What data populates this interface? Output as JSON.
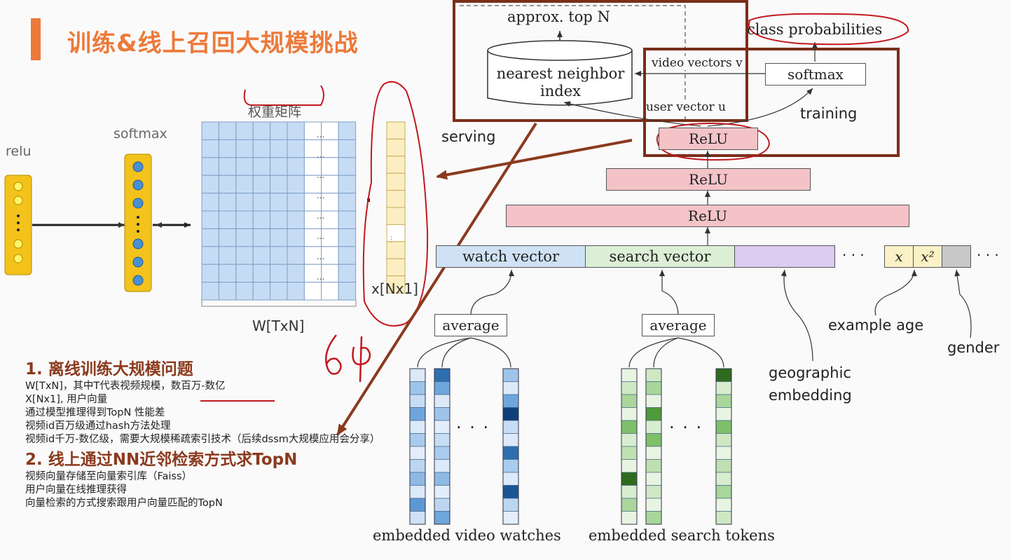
{
  "header": {
    "title": "训练&线上召回大规模挑战"
  },
  "left_diagram": {
    "relu_label": "relu",
    "softmax_label": "softmax",
    "matrix_title": "权重矩阵",
    "matrix_dots": "...",
    "matrix_caption": "W[TxN]",
    "vector_caption": "x[Nx1]",
    "vector_dots": "...",
    "handwritten_number": "64"
  },
  "notes": {
    "section1_title": "1. 离线训练大规模问题",
    "line1_a": "W[TxN]，其中T代表视频规模，",
    "line1_b": "数百万-数亿",
    "line2": "X[Nx1], 用户向量",
    "line3": "通过模型推理得到TopN 性能差",
    "line4": "视频id百万级通过hash方法处理",
    "line5": "视频id千万-数亿级，需要大规模稀疏索引技术（后续dssm大规模应用会分享）",
    "section2_title": "2. 线上通过NN近邻检索方式求TopN",
    "line6": "视频向量存储至向量索引库（Faiss）",
    "line7": "用户向量在线推理获得",
    "line8": "向量检索的方式搜索跟用户向量匹配的TopN"
  },
  "arch_diagram": {
    "approx_top": "approx. top N",
    "class_probabilities": "class probabilities",
    "nn_index_line1": "nearest neighbor",
    "nn_index_line2": "index",
    "video_vectors": "video vectors v",
    "softmax": "softmax",
    "user_vector": "user vector u",
    "training": "training",
    "serving": "serving",
    "relu": "ReLU",
    "watch_vector": "watch vector",
    "search_vector": "search vector",
    "ellipsis": "· · ·",
    "x_label": "x",
    "x2_label": "x²",
    "average": "average",
    "example_age": "example age",
    "gender": "gender",
    "geo_line1": "geographic",
    "geo_line2": "embedding",
    "embedded_video_watches": "embedded video watches",
    "embedded_search_tokens": "embedded search tokens"
  },
  "colors": {
    "title_orange": "#ec7a3a",
    "annotation_red": "#c2181f",
    "frame_brown": "#7a2e1a",
    "relu_pink": "#f4c3c8",
    "watch_blue": "#cfe2f5",
    "search_green": "#dcefd6",
    "geo_purple": "#dccaf0",
    "age_yellow": "#fbf1c6",
    "gender_gray": "#c8c8c8"
  }
}
